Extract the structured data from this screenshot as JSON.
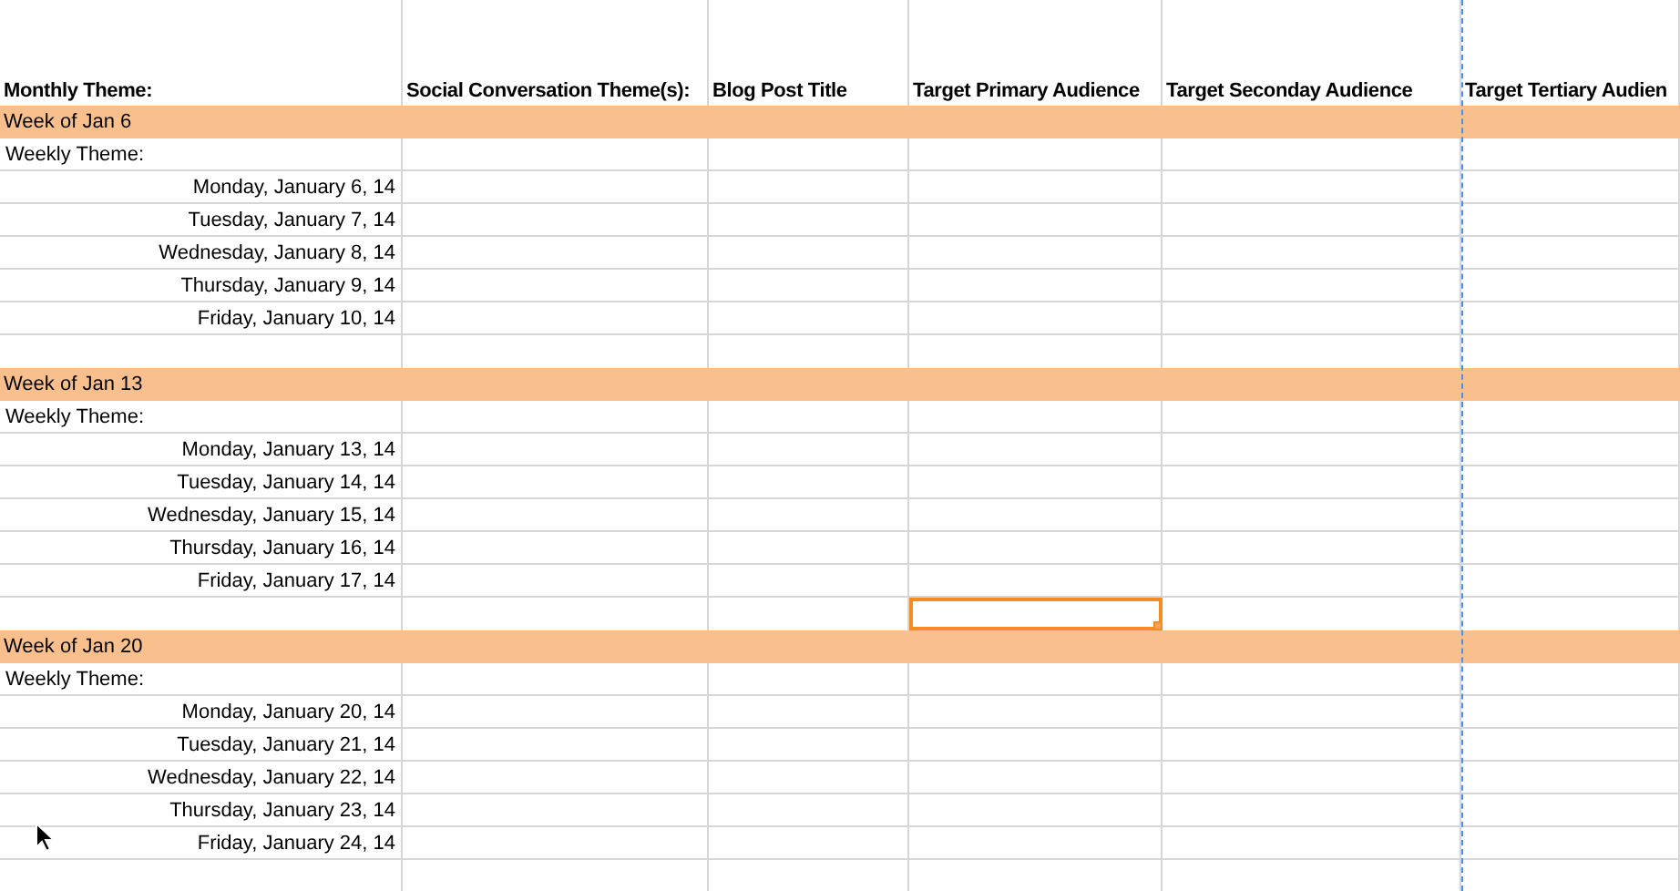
{
  "columns": [
    "Monthly Theme:",
    "Social Conversation Theme(s):",
    "Blog Post Title",
    "Target Primary Audience",
    "Target Seconday Audience",
    "Target Tertiary Audien"
  ],
  "weeks": [
    {
      "label": "Week of Jan 6",
      "weekly_theme": "Weekly Theme:",
      "days": [
        "Monday, January 6, 14",
        "Tuesday, January 7, 14",
        "Wednesday, January 8, 14",
        "Thursday, January 9, 14",
        "Friday, January 10, 14"
      ],
      "trailing_cells": [
        {
          "selected": false
        },
        {
          "selected": false
        },
        {
          "selected": false
        },
        {
          "selected": false
        },
        {
          "selected": false
        },
        {
          "selected": false
        }
      ]
    },
    {
      "label": "Week of Jan 13",
      "weekly_theme": "Weekly Theme:",
      "days": [
        "Monday, January 13, 14",
        "Tuesday, January 14, 14",
        "Wednesday, January 15, 14",
        "Thursday, January 16, 14",
        "Friday, January 17, 14"
      ],
      "trailing_cells": [
        {
          "selected": false
        },
        {
          "selected": false
        },
        {
          "selected": false
        },
        {
          "selected": true
        },
        {
          "selected": false
        },
        {
          "selected": false
        }
      ]
    },
    {
      "label": "Week of Jan 20",
      "weekly_theme": "Weekly Theme:",
      "days": [
        "Monday, January 20, 14",
        "Tuesday, January 21, 14",
        "Wednesday, January 22, 14",
        "Thursday, January 23, 14",
        "Friday, January 24, 14"
      ],
      "trailing_cells": [
        {
          "selected": false
        },
        {
          "selected": false
        },
        {
          "selected": false
        },
        {
          "selected": false
        },
        {
          "selected": false
        },
        {
          "selected": false
        }
      ]
    }
  ]
}
